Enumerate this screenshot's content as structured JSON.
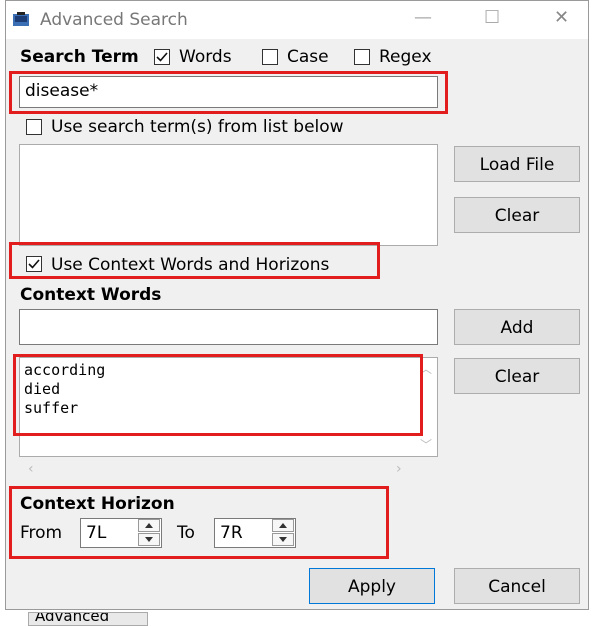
{
  "window": {
    "title": "Advanced Search",
    "minimize": "—",
    "maximize": "☐",
    "close": "✕"
  },
  "search": {
    "label": "Search Term",
    "words_label": "Words",
    "words_checked": true,
    "case_label": "Case",
    "case_checked": false,
    "regex_label": "Regex",
    "regex_checked": false,
    "term_value": "disease*",
    "use_list_label": "Use search term(s) from list below",
    "use_list_checked": false,
    "load_file": "Load File",
    "clear_list": "Clear"
  },
  "context": {
    "use_label": "Use Context Words and Horizons",
    "use_checked": true,
    "words_heading": "Context Words",
    "add": "Add",
    "clear": "Clear",
    "words": [
      "according",
      "died",
      "suffer"
    ],
    "horizon_heading": "Context Horizon",
    "from_label": "From",
    "from_value": "7L",
    "to_label": "To",
    "to_value": "7R"
  },
  "footer": {
    "apply": "Apply",
    "cancel": "Cancel"
  },
  "background": {
    "bottom_tab": "Advanced"
  }
}
